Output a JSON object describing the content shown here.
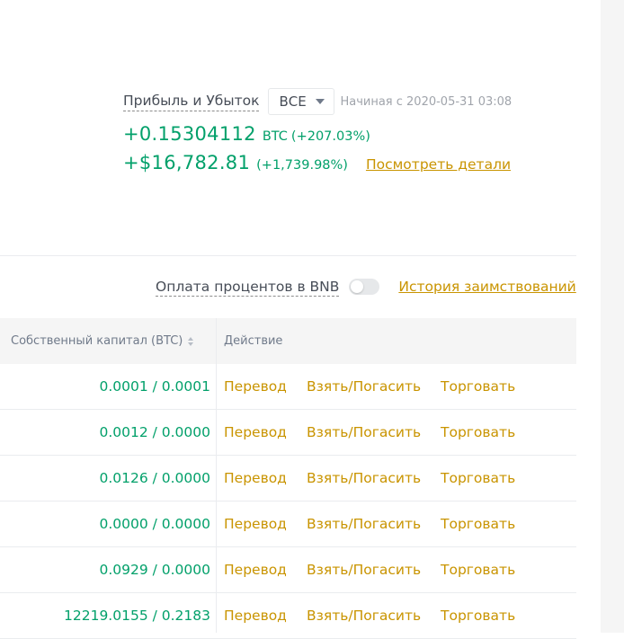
{
  "pnl": {
    "label": "Прибыль и Убыток",
    "filter_value": "ВСЕ",
    "since": "Начиная с 2020-05-31 03:08",
    "btc_value": "+0.15304112",
    "btc_unit": "BTC",
    "btc_pct": "(+207.03%)",
    "usd_value": "+$16,782.81",
    "usd_pct": "(+1,739.98%)",
    "details_link": "Посмотреть детали"
  },
  "bnb": {
    "label": "Оплата процентов в BNB",
    "toggle_on": false,
    "history_link": "История заимствований"
  },
  "table": {
    "headers": {
      "equity": "Собственный капитал (BTC)",
      "action": "Действие"
    },
    "rows": [
      {
        "equity": "0.0001 / 0.0001",
        "transfer": "Перевод",
        "borrow": "Взять/Погасить",
        "trade": "Торговать"
      },
      {
        "equity": "0.0012 / 0.0000",
        "transfer": "Перевод",
        "borrow": "Взять/Погасить",
        "trade": "Торговать"
      },
      {
        "equity": "0.0126 / 0.0000",
        "transfer": "Перевод",
        "borrow": "Взять/Погасить",
        "trade": "Торговать"
      },
      {
        "equity": "0.0000 / 0.0000",
        "transfer": "Перевод",
        "borrow": "Взять/Погасить",
        "trade": "Торговать"
      },
      {
        "equity": "0.0929 / 0.0000",
        "transfer": "Перевод",
        "borrow": "Взять/Погасить",
        "trade": "Торговать"
      },
      {
        "equity": "12219.0155 / 0.2183",
        "transfer": "Перевод",
        "borrow": "Взять/Погасить",
        "trade": "Торговать"
      }
    ]
  },
  "colors": {
    "positive": "#02a06a",
    "link": "#c99400",
    "header_bg": "#f5f5f5"
  }
}
